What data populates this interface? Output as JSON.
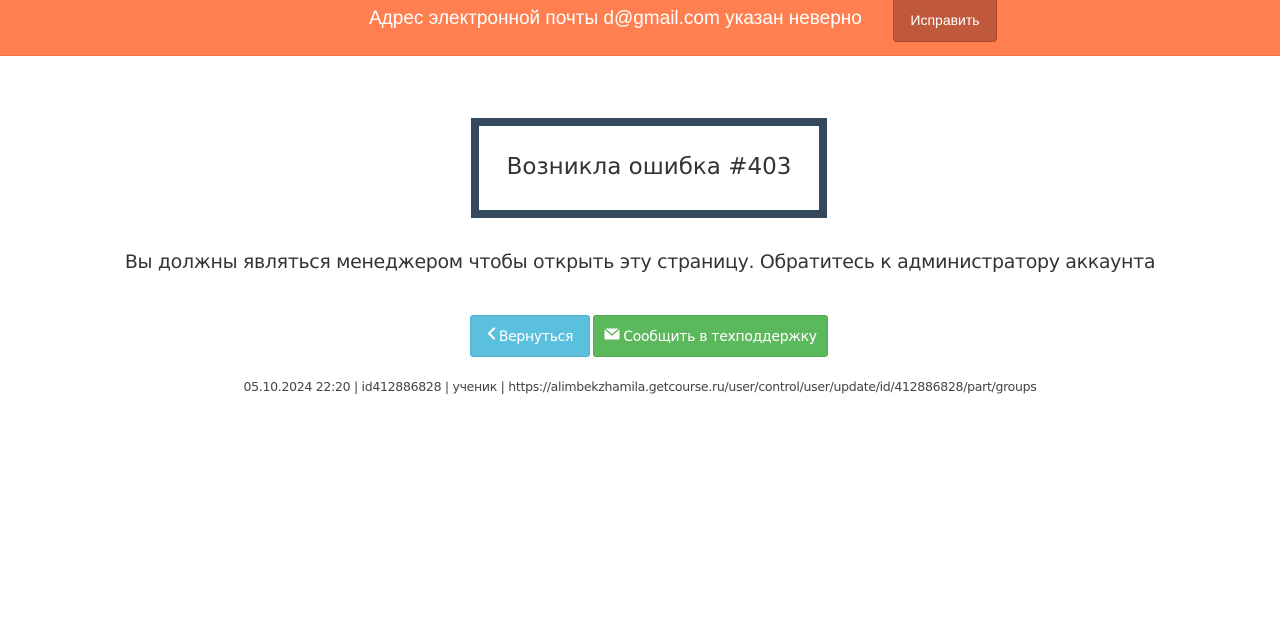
{
  "notice": {
    "text": "Адрес электронной почты d@gmail.com указан неверно",
    "fix_label": "Исправить"
  },
  "error": {
    "title": "Возникла ошибка #403",
    "message": "Вы должны являться менеджером чтобы открыть эту страницу. Обратитесь к администратору аккаунта"
  },
  "actions": {
    "back_label": "Вернуться",
    "back_icon": "chevron-left-icon",
    "support_label": "Сообщить в техподдержку",
    "support_icon": "envelope-icon"
  },
  "meta": {
    "line": "05.10.2024 22:20 | id412886828 | ученик | https://alimbekzhamila.getcourse.ru/user/control/user/update/id/412886828/part/groups"
  },
  "colors": {
    "notice_bg": "#ff7f50",
    "fix_button_bg": "#c0583b",
    "error_border": "#34495e",
    "back_button_bg": "#5bc0de",
    "support_button_bg": "#5cb85c"
  }
}
